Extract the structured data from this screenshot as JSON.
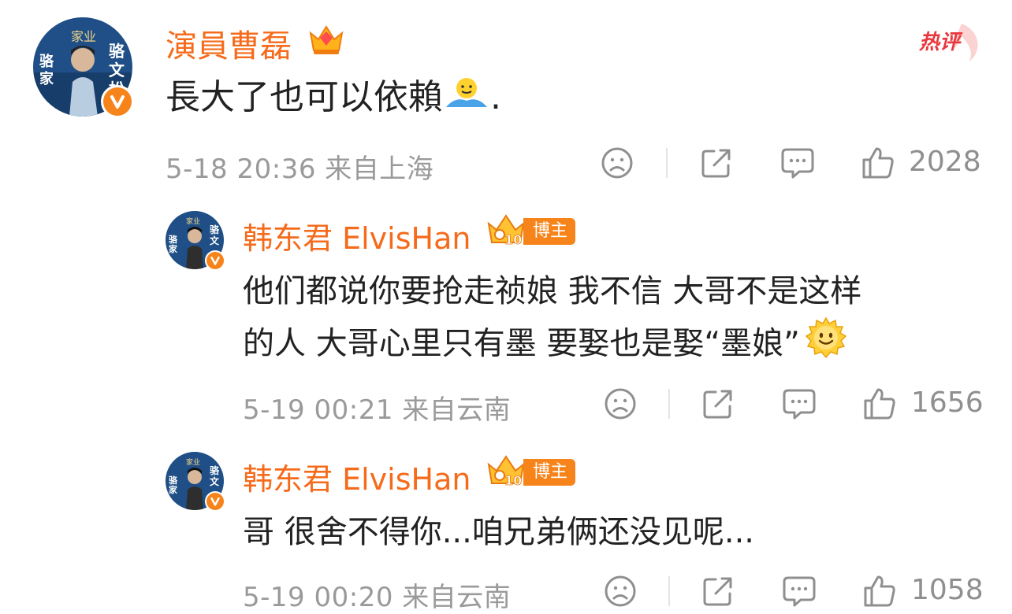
{
  "hot_label": "热评",
  "comments": [
    {
      "user": "演員曹磊",
      "avatar_text": [
        "家业",
        "骆文松",
        "骆家"
      ],
      "text": "長大了也可以依賴",
      "text_suffix": ".",
      "timestamp": "5-18 20:36",
      "location": "来自上海",
      "likes": "2028"
    }
  ],
  "replies": [
    {
      "user": "韩东君 ElvisHan",
      "badge": "博主",
      "badge_num": "10",
      "avatar_text": [
        "家业",
        "骆文松",
        "骆家"
      ],
      "text_lines": [
        "他们都说你要抢走祯娘  我不信  大哥不是这样",
        "的人  大哥心里只有墨  要娶也是娶“墨娘”"
      ],
      "timestamp": "5-19 00:21",
      "location": "来自云南",
      "likes": "1656"
    },
    {
      "user": "韩东君 ElvisHan",
      "badge": "博主",
      "badge_num": "10",
      "avatar_text": [
        "家业",
        "骆文松",
        "骆家"
      ],
      "text_lines": [
        "哥 很舍不得你...咱兄弟俩还没见呢..."
      ],
      "timestamp": "5-19 00:20",
      "location": "来自云南",
      "likes": "1058"
    }
  ],
  "icons": {
    "dislike": "sad-face-icon",
    "repost": "share-icon",
    "reply": "comment-icon",
    "like": "thumbs-up-icon"
  },
  "colors": {
    "username": "#f56b1b",
    "badge": "#f7841b",
    "meta": "#9a9a9a"
  }
}
